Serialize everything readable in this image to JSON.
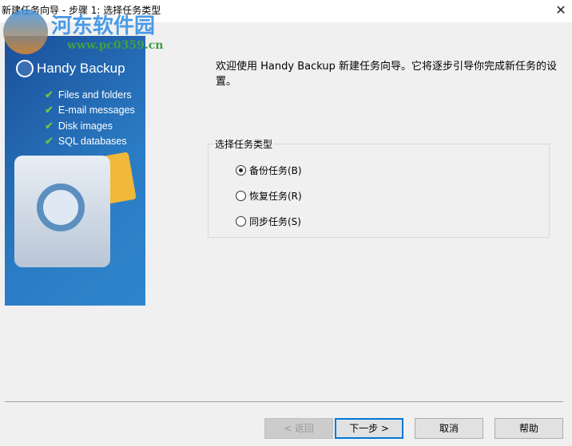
{
  "window": {
    "title": "新建任务向导 - 步骤 1: 选择任务类型",
    "close_label": "✕"
  },
  "watermark": {
    "name": "河东软件园",
    "url": "www.pc0359.cn"
  },
  "banner": {
    "brand": "Handy Backup",
    "features": [
      "Files and folders",
      "E-mail messages",
      "Disk images",
      "SQL databases"
    ]
  },
  "intro": "欢迎使用 Handy Backup 新建任务向导。它将逐步引导你完成新任务的设置。",
  "task_type": {
    "label": "选择任务类型",
    "options": [
      {
        "label": "备份任务(B)",
        "selected": true
      },
      {
        "label": "恢复任务(R)",
        "selected": false
      },
      {
        "label": "同步任务(S)",
        "selected": false
      }
    ]
  },
  "buttons": {
    "back": "< 返回",
    "next": "下一步 >",
    "cancel": "取消",
    "help": "帮助"
  }
}
